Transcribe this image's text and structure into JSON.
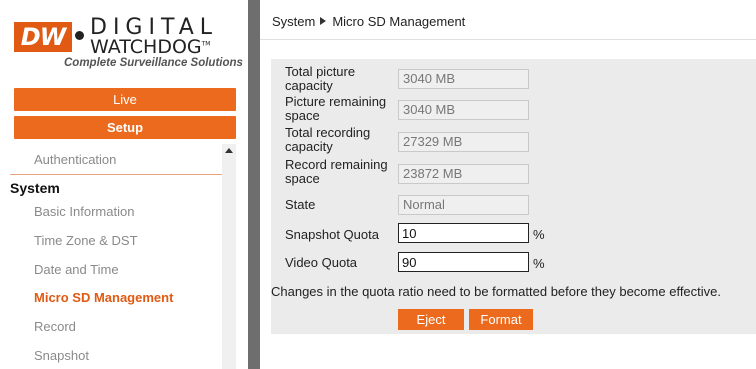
{
  "logo": {
    "mark": "DW",
    "line1": "DIGITAL",
    "line2": "WATCHDOG",
    "tm": "TM",
    "tagline": "Complete Surveillance Solutions"
  },
  "nav": {
    "live_label": "Live",
    "setup_label": "Setup"
  },
  "menu": {
    "items_top": [
      "Authentication"
    ],
    "group": "System",
    "items": [
      {
        "label": "Basic Information",
        "active": false
      },
      {
        "label": "Time Zone & DST",
        "active": false
      },
      {
        "label": "Date and Time",
        "active": false
      },
      {
        "label": "Micro SD Management",
        "active": true
      },
      {
        "label": "Record",
        "active": false
      },
      {
        "label": "Snapshot",
        "active": false
      }
    ]
  },
  "breadcrumb": {
    "section": "System",
    "page": "Micro SD Management"
  },
  "form": {
    "total_picture_label": "Total picture capacity",
    "total_picture_value": "3040 MB",
    "picture_remaining_label": "Picture remaining space",
    "picture_remaining_value": "3040 MB",
    "total_recording_label": "Total recording capacity",
    "total_recording_value": "27329 MB",
    "record_remaining_label": "Record remaining space",
    "record_remaining_value": "23872 MB",
    "state_label": "State",
    "state_value": "Normal",
    "snapshot_quota_label": "Snapshot Quota",
    "snapshot_quota_value": "10",
    "video_quota_label": "Video Quota",
    "video_quota_value": "90",
    "percent_sign": "%",
    "note": "Changes in the quota ratio need to be formatted before they become effective.",
    "eject_label": "Eject",
    "format_label": "Format"
  },
  "colors": {
    "accent": "#ec6a1e",
    "active_text": "#e05a13",
    "divider": "#6e6e6e",
    "panel_bg": "#ebebeb"
  }
}
